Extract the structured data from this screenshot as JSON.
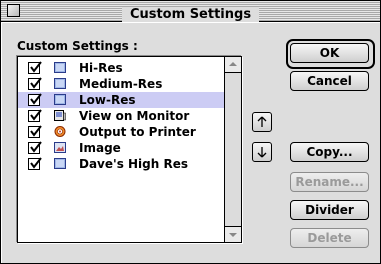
{
  "window": {
    "title": "Custom Settings"
  },
  "list": {
    "label": "Custom Settings :",
    "items": [
      {
        "label": "Hi-Res",
        "checked": true,
        "icon": "document-icon",
        "selected": false
      },
      {
        "label": "Medium-Res",
        "checked": true,
        "icon": "document-icon",
        "selected": false
      },
      {
        "label": "Low-Res",
        "checked": true,
        "icon": "document-icon",
        "selected": true
      },
      {
        "label": "View on Monitor",
        "checked": true,
        "icon": "monitor-icon",
        "selected": false
      },
      {
        "label": "Output to Printer",
        "checked": true,
        "icon": "printer-icon",
        "selected": false
      },
      {
        "label": "Image",
        "checked": true,
        "icon": "image-icon",
        "selected": false
      },
      {
        "label": "Dave's High Res",
        "checked": true,
        "icon": "document-icon",
        "selected": false
      }
    ]
  },
  "buttons": {
    "ok": "OK",
    "cancel": "Cancel",
    "copy": "Copy...",
    "rename": "Rename...",
    "divider": "Divider",
    "delete": "Delete"
  },
  "move": {
    "up": "↑",
    "down": "↓"
  },
  "colors": {
    "selection": "#ccccf4",
    "window_bg": "#dddddd",
    "disabled_text": "#9a9a9a"
  }
}
